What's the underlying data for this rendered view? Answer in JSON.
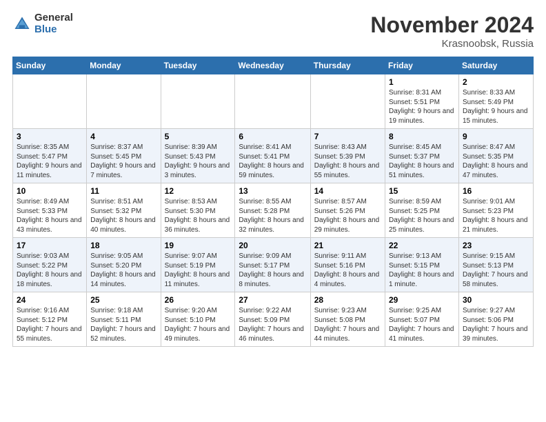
{
  "logo": {
    "general": "General",
    "blue": "Blue"
  },
  "title": "November 2024",
  "location": "Krasnoobsk, Russia",
  "days_of_week": [
    "Sunday",
    "Monday",
    "Tuesday",
    "Wednesday",
    "Thursday",
    "Friday",
    "Saturday"
  ],
  "weeks": [
    [
      {
        "day": "",
        "info": ""
      },
      {
        "day": "",
        "info": ""
      },
      {
        "day": "",
        "info": ""
      },
      {
        "day": "",
        "info": ""
      },
      {
        "day": "",
        "info": ""
      },
      {
        "day": "1",
        "info": "Sunrise: 8:31 AM\nSunset: 5:51 PM\nDaylight: 9 hours and 19 minutes."
      },
      {
        "day": "2",
        "info": "Sunrise: 8:33 AM\nSunset: 5:49 PM\nDaylight: 9 hours and 15 minutes."
      }
    ],
    [
      {
        "day": "3",
        "info": "Sunrise: 8:35 AM\nSunset: 5:47 PM\nDaylight: 9 hours and 11 minutes."
      },
      {
        "day": "4",
        "info": "Sunrise: 8:37 AM\nSunset: 5:45 PM\nDaylight: 9 hours and 7 minutes."
      },
      {
        "day": "5",
        "info": "Sunrise: 8:39 AM\nSunset: 5:43 PM\nDaylight: 9 hours and 3 minutes."
      },
      {
        "day": "6",
        "info": "Sunrise: 8:41 AM\nSunset: 5:41 PM\nDaylight: 8 hours and 59 minutes."
      },
      {
        "day": "7",
        "info": "Sunrise: 8:43 AM\nSunset: 5:39 PM\nDaylight: 8 hours and 55 minutes."
      },
      {
        "day": "8",
        "info": "Sunrise: 8:45 AM\nSunset: 5:37 PM\nDaylight: 8 hours and 51 minutes."
      },
      {
        "day": "9",
        "info": "Sunrise: 8:47 AM\nSunset: 5:35 PM\nDaylight: 8 hours and 47 minutes."
      }
    ],
    [
      {
        "day": "10",
        "info": "Sunrise: 8:49 AM\nSunset: 5:33 PM\nDaylight: 8 hours and 43 minutes."
      },
      {
        "day": "11",
        "info": "Sunrise: 8:51 AM\nSunset: 5:32 PM\nDaylight: 8 hours and 40 minutes."
      },
      {
        "day": "12",
        "info": "Sunrise: 8:53 AM\nSunset: 5:30 PM\nDaylight: 8 hours and 36 minutes."
      },
      {
        "day": "13",
        "info": "Sunrise: 8:55 AM\nSunset: 5:28 PM\nDaylight: 8 hours and 32 minutes."
      },
      {
        "day": "14",
        "info": "Sunrise: 8:57 AM\nSunset: 5:26 PM\nDaylight: 8 hours and 29 minutes."
      },
      {
        "day": "15",
        "info": "Sunrise: 8:59 AM\nSunset: 5:25 PM\nDaylight: 8 hours and 25 minutes."
      },
      {
        "day": "16",
        "info": "Sunrise: 9:01 AM\nSunset: 5:23 PM\nDaylight: 8 hours and 21 minutes."
      }
    ],
    [
      {
        "day": "17",
        "info": "Sunrise: 9:03 AM\nSunset: 5:22 PM\nDaylight: 8 hours and 18 minutes."
      },
      {
        "day": "18",
        "info": "Sunrise: 9:05 AM\nSunset: 5:20 PM\nDaylight: 8 hours and 14 minutes."
      },
      {
        "day": "19",
        "info": "Sunrise: 9:07 AM\nSunset: 5:19 PM\nDaylight: 8 hours and 11 minutes."
      },
      {
        "day": "20",
        "info": "Sunrise: 9:09 AM\nSunset: 5:17 PM\nDaylight: 8 hours and 8 minutes."
      },
      {
        "day": "21",
        "info": "Sunrise: 9:11 AM\nSunset: 5:16 PM\nDaylight: 8 hours and 4 minutes."
      },
      {
        "day": "22",
        "info": "Sunrise: 9:13 AM\nSunset: 5:15 PM\nDaylight: 8 hours and 1 minute."
      },
      {
        "day": "23",
        "info": "Sunrise: 9:15 AM\nSunset: 5:13 PM\nDaylight: 7 hours and 58 minutes."
      }
    ],
    [
      {
        "day": "24",
        "info": "Sunrise: 9:16 AM\nSunset: 5:12 PM\nDaylight: 7 hours and 55 minutes."
      },
      {
        "day": "25",
        "info": "Sunrise: 9:18 AM\nSunset: 5:11 PM\nDaylight: 7 hours and 52 minutes."
      },
      {
        "day": "26",
        "info": "Sunrise: 9:20 AM\nSunset: 5:10 PM\nDaylight: 7 hours and 49 minutes."
      },
      {
        "day": "27",
        "info": "Sunrise: 9:22 AM\nSunset: 5:09 PM\nDaylight: 7 hours and 46 minutes."
      },
      {
        "day": "28",
        "info": "Sunrise: 9:23 AM\nSunset: 5:08 PM\nDaylight: 7 hours and 44 minutes."
      },
      {
        "day": "29",
        "info": "Sunrise: 9:25 AM\nSunset: 5:07 PM\nDaylight: 7 hours and 41 minutes."
      },
      {
        "day": "30",
        "info": "Sunrise: 9:27 AM\nSunset: 5:06 PM\nDaylight: 7 hours and 39 minutes."
      }
    ]
  ]
}
